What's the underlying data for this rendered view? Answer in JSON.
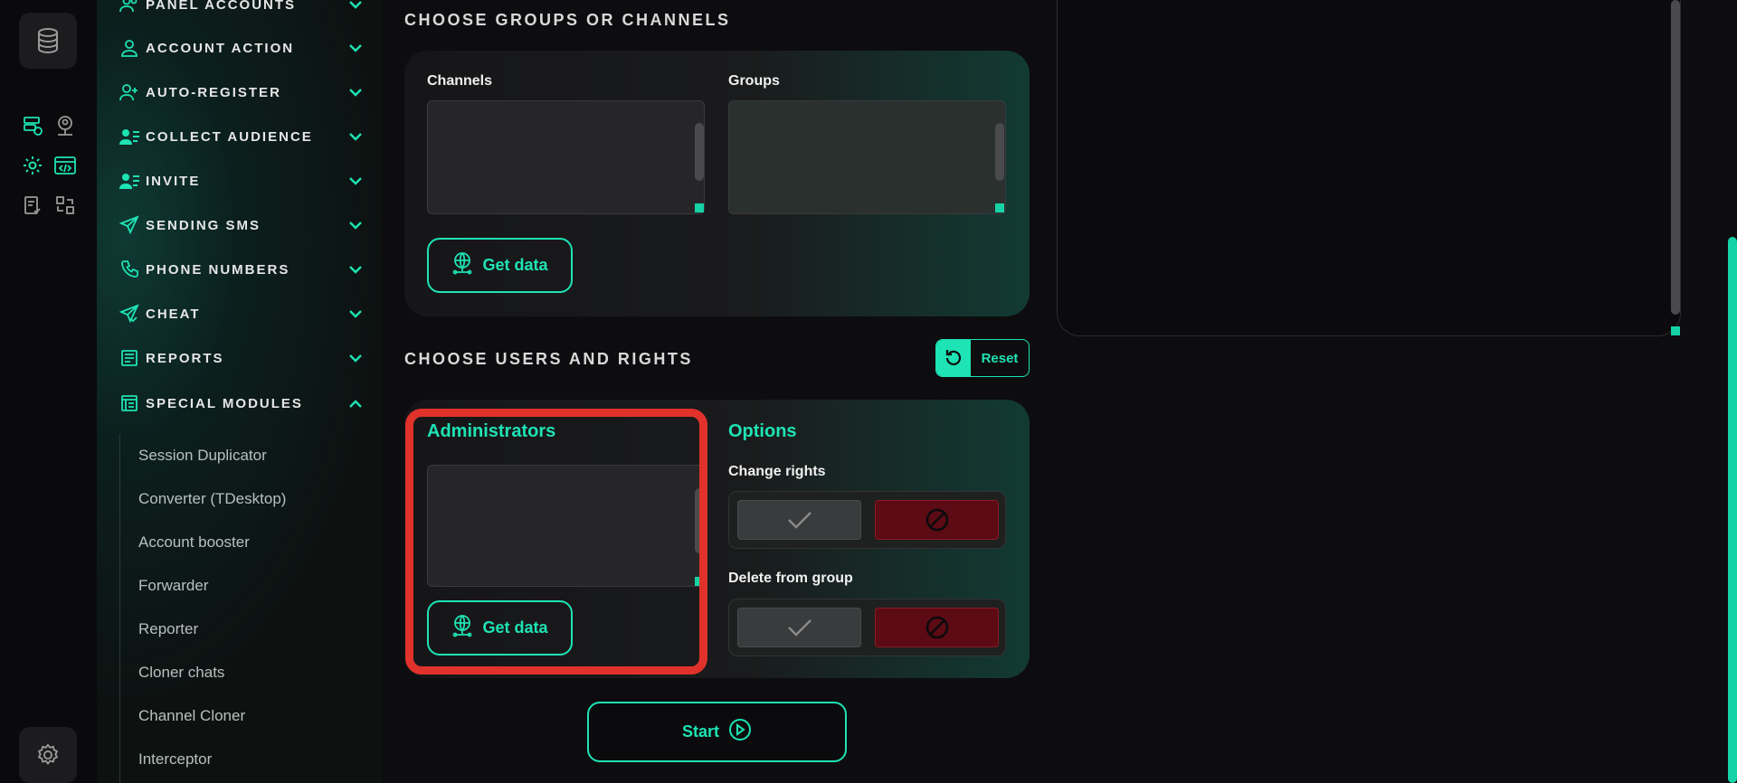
{
  "sidebar": {
    "nav_items": [
      {
        "label": "PANEL ACCOUNTS",
        "icon": "users-icon",
        "expanded": false
      },
      {
        "label": "ACCOUNT ACTION",
        "icon": "user-icon",
        "expanded": false
      },
      {
        "label": "AUTO-REGISTER",
        "icon": "user-plus-icon",
        "expanded": false
      },
      {
        "label": "COLLECT AUDIENCE",
        "icon": "user-list-icon",
        "expanded": false
      },
      {
        "label": "INVITE",
        "icon": "user-list-icon",
        "expanded": false
      },
      {
        "label": "SENDING SMS",
        "icon": "paper-plane-icon",
        "expanded": false
      },
      {
        "label": "PHONE NUMBERS",
        "icon": "phone-icon",
        "expanded": false
      },
      {
        "label": "CHEAT",
        "icon": "plane-check-icon",
        "expanded": false
      },
      {
        "label": "REPORTS",
        "icon": "report-icon",
        "expanded": false
      },
      {
        "label": "SPECIAL MODULES",
        "icon": "modules-icon",
        "expanded": true
      }
    ],
    "sub_items": [
      "Session Duplicator",
      "Converter (TDesktop)",
      "Account booster",
      "Forwarder",
      "Reporter",
      "Cloner chats",
      "Channel Cloner",
      "Interceptor"
    ]
  },
  "groups_section": {
    "title": "CHOOSE GROUPS OR CHANNELS",
    "channels_label": "Channels",
    "groups_label": "Groups",
    "channels_value": "",
    "groups_value": "",
    "get_data_label": "Get data"
  },
  "users_section": {
    "title": "CHOOSE USERS AND RIGHTS",
    "reset_label": "Reset",
    "administrators_label": "Administrators",
    "administrators_value": "",
    "get_data_label": "Get data",
    "options_label": "Options",
    "change_rights_label": "Change rights",
    "delete_from_group_label": "Delete from group"
  },
  "start_label": "Start",
  "colors": {
    "accent": "#1ee3b4",
    "danger": "#5c0a14",
    "highlight": "#e0322b"
  }
}
